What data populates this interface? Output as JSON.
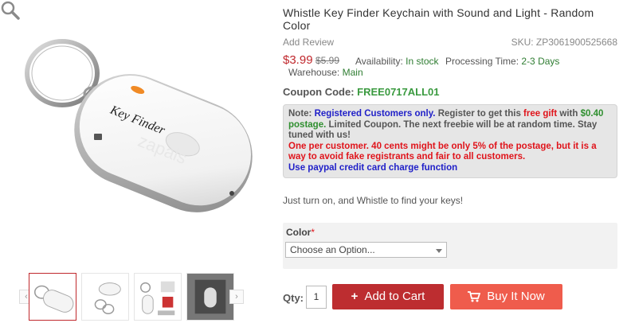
{
  "product": {
    "title": "Whistle Key Finder Keychain with Sound and Light - Random Color",
    "add_review": "Add Review",
    "sku": "SKU: ZP3061900525668",
    "price": "$3.99",
    "old_price": "$5.99",
    "availability_label": "Availability:",
    "availability_value": "In stock",
    "processing_label": "Processing Time:",
    "processing_value": "2-3 Days",
    "warehouse_label": "Warehouse:",
    "warehouse_value": "Main",
    "image_text": "Key Finder",
    "watermark": "zapals",
    "description": "Just turn on, and Whistle to find your keys!"
  },
  "coupon": {
    "label": "Coupon Code:",
    "code": "FREE0717ALL01"
  },
  "note": {
    "prefix": "Note:",
    "registered": "Registered Customers only.",
    "line1_mid": "Register to get this",
    "free_gift": "free gift",
    "with": "with",
    "amount": "$0.40 postage.",
    "line1_rest": "Limited Coupon. The next freebie will be at random time. Stay tuned with us!",
    "red_text": "One per customer. 40 cents might be only 5% of the postage, but it is a way to avoid fake registrants and fair to all customers.",
    "paypal": "Use paypal credit card charge function"
  },
  "options": {
    "color_label": "Color",
    "required_mark": "*",
    "select_value": "Choose an Option..."
  },
  "purchase": {
    "qty_label": "Qty:",
    "qty_value": "1",
    "add_to_cart_icon": "+",
    "add_to_cart": "Add to Cart",
    "buy_now": "Buy It Now"
  },
  "gallery": {
    "prev_icon": "‹",
    "next_icon": "›",
    "zoom_icon": "magnifier-icon"
  },
  "colors": {
    "price": "#c0282d",
    "in_stock": "#2f7d32",
    "coupon_code": "#3a9a3f",
    "add_to_cart_bg": "#bd2d30",
    "buy_now_bg": "#ef5c4c"
  }
}
